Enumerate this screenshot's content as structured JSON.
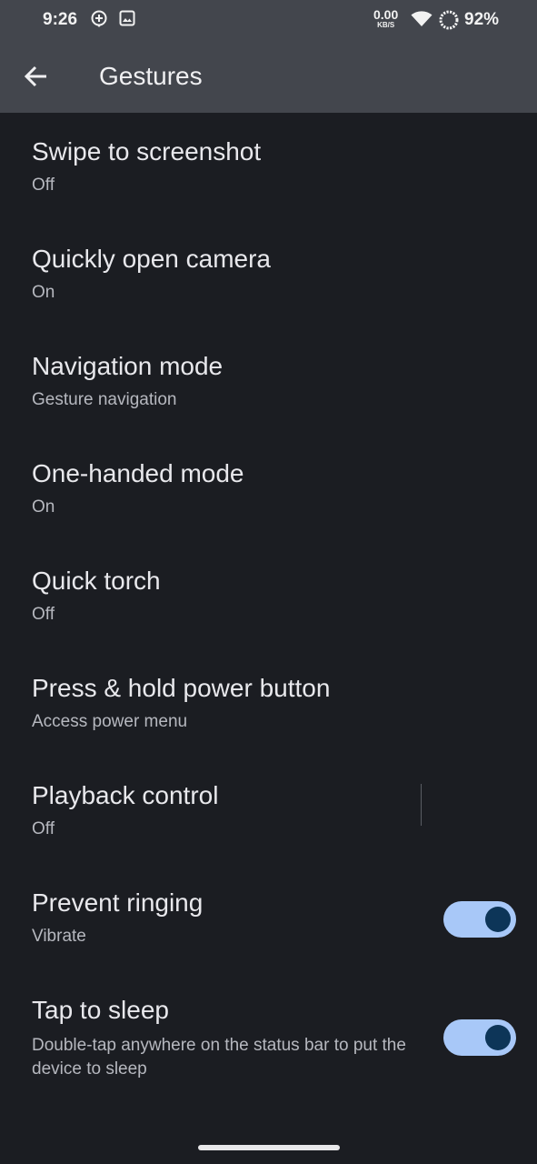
{
  "status_bar": {
    "time": "9:26",
    "net_speed_value": "0.00",
    "net_speed_unit": "KB/S",
    "battery_percent": "92%",
    "icons": [
      "location-plus-icon",
      "image-icon",
      "wifi-icon",
      "battery-ring-icon"
    ]
  },
  "app_bar": {
    "title": "Gestures",
    "back_icon": "arrow-back-icon"
  },
  "settings": [
    {
      "title": "Swipe to screenshot",
      "subtitle": "Off"
    },
    {
      "title": "Quickly open camera",
      "subtitle": "On"
    },
    {
      "title": "Navigation mode",
      "subtitle": "Gesture navigation"
    },
    {
      "title": "One-handed mode",
      "subtitle": "On"
    },
    {
      "title": "Quick torch",
      "subtitle": "Off"
    },
    {
      "title": "Press & hold power button",
      "subtitle": "Access power menu"
    },
    {
      "title": "Playback control",
      "subtitle": "Off"
    },
    {
      "title": "Prevent ringing",
      "subtitle": "Vibrate",
      "toggle": true
    },
    {
      "title": "Tap to sleep",
      "subtitle": "Double-tap anywhere on the status bar to put the device to sleep",
      "toggle": true
    }
  ],
  "colors": {
    "background": "#1b1d22",
    "app_bar": "#43464d",
    "toggle_track": "#a8c8f8",
    "toggle_knob": "#0d3558"
  }
}
